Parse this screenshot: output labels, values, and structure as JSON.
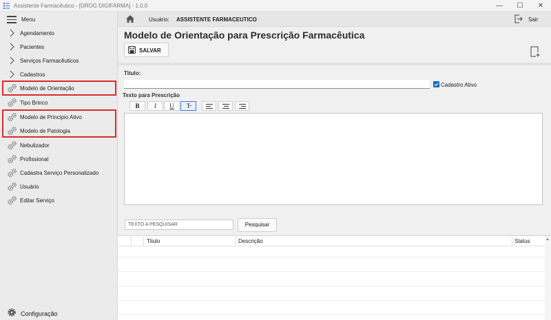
{
  "window": {
    "title": "Assistente Farmacêutico - [DROG DIGIFARMA] - 1.0.0",
    "controls": {
      "minimize": "—",
      "maximize": "☐",
      "close": "✕"
    }
  },
  "sidebar": {
    "menu_label": "Menu",
    "items": [
      {
        "label": "Agendamento",
        "icon": "chevron-right-icon"
      },
      {
        "label": "Pacientes",
        "icon": "chevron-right-icon"
      },
      {
        "label": "Serviços Farmacêuticos",
        "icon": "chevron-right-icon"
      },
      {
        "label": "Cadastros",
        "icon": "chevron-right-icon"
      },
      {
        "label": "Modelo de Orientação",
        "icon": "gears-icon",
        "highlighted": true
      },
      {
        "label": "Tipo Brinco",
        "icon": "gears-icon"
      },
      {
        "label": "Modelo de Principio Ativo",
        "icon": "gears-icon",
        "highlighted": true
      },
      {
        "label": "Modelo de Patologia",
        "icon": "gears-icon",
        "highlighted": true
      },
      {
        "label": "Nebulizador",
        "icon": "gears-icon"
      },
      {
        "label": "Profissional",
        "icon": "gears-icon"
      },
      {
        "label": "Cadastra Serviço Personalizado",
        "icon": "gears-icon"
      },
      {
        "label": "Usuário",
        "icon": "gears-icon"
      },
      {
        "label": "Editar Serviço",
        "icon": "gears-icon"
      }
    ],
    "footer_label": "Configuração",
    "highlight_color": "#d92b2b"
  },
  "header": {
    "user_label": "Usuário:",
    "user_value": "ASSISTENTE FARMACEUTICO",
    "exit_label": "Sair"
  },
  "page": {
    "title": "Modelo de Orientação para Prescrição Farmacêutica",
    "save_label": "SALVAR"
  },
  "form": {
    "titulo_label": "Titulo:",
    "titulo_value": "",
    "cadastro_ativo_label": "Cadastro Ativo",
    "cadastro_ativo_checked": true,
    "texto_label": "Texto para Prescrição",
    "format_buttons": {
      "bold": "B",
      "italic": "I",
      "underline": "U",
      "strike": "T̶"
    },
    "active_format": "strike",
    "editor_value": ""
  },
  "search": {
    "placeholder": "TEXTO A PESQUISAR",
    "value": "",
    "button_label": "Pesquisar"
  },
  "grid": {
    "columns": [
      "Titulo",
      "Descrição",
      "Status"
    ],
    "rows": []
  },
  "colors": {
    "accent": "#1565c0"
  }
}
